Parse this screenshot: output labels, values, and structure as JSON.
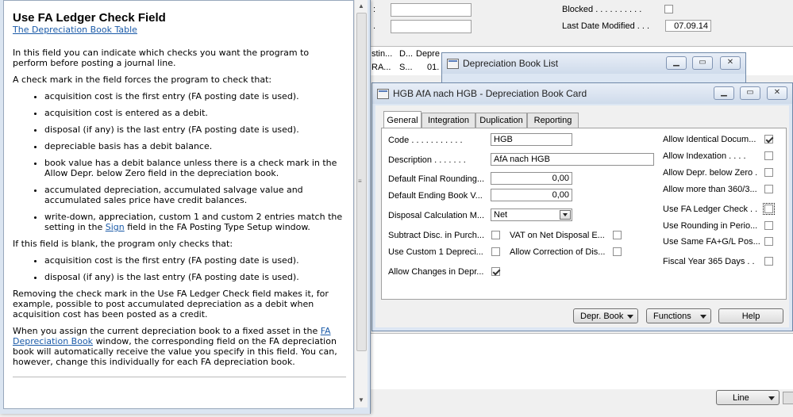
{
  "help": {
    "title": "Use FA Ledger Check Field",
    "link_top": "The Depreciation Book Table",
    "p1": "In this field you can indicate which checks you want the program to perform before posting a journal line.",
    "p2": "A check mark in the field forces the program to check that:",
    "list1": [
      "acquisition cost is the first entry (FA posting date is used).",
      "acquisition cost is entered as a debit.",
      "disposal (if any) is the last entry (FA posting date is used).",
      "depreciable basis has a debit balance.",
      "book value has a debit balance unless there is a check mark in the Allow Depr. below Zero field in the depreciation book.",
      "accumulated depreciation, accumulated salvage value and accumulated sales price have credit balances."
    ],
    "list1_last_pre": "write-down, appreciation, custom 1 and custom 2 entries match the setting in the",
    "list1_last_link": "Sign",
    "list1_last_post": "field in the FA Posting Type Setup window.",
    "p3": "If this field is blank, the program only checks that:",
    "list2": [
      "acquisition cost is the first entry (FA posting date is used).",
      "disposal (if any) is the last entry (FA posting date is used)."
    ],
    "p4": "Removing the check mark in the Use FA Ledger Check field makes it, for example, possible to post accumulated depreciation as a debit when acquisition cost has been posted as a credit.",
    "p5_pre": "When you assign the current depreciation book to a fixed asset in the",
    "p5_link": "FA Depreciation Book",
    "p5_post": "window, the corresponding field on the FA depreciation book will automatically receive the value you specify in this field. You can, however, change this individually for each FA depreciation book."
  },
  "background": {
    "blocked_label": "Blocked . . . . . . . . . .",
    "last_modified_label": "Last Date Modified . . .",
    "last_modified_value": "07.09.14",
    "col_headers": [
      "stin...",
      "D...",
      "Depre"
    ],
    "row_cells": [
      "RA...",
      "S...",
      "01."
    ],
    "line_button": "Line"
  },
  "list_window": {
    "title": "Depreciation Book List"
  },
  "card": {
    "title": "HGB AfA nach HGB - Depreciation Book Card",
    "tabs": [
      "General",
      "Integration",
      "Duplication",
      "Reporting"
    ],
    "code_label": "Code . . . . . . . . . . .",
    "code_value": "HGB",
    "description_label": "Description . . . . . . .",
    "description_value": "AfA nach HGB",
    "default_final_label": "Default Final Rounding...",
    "default_final_value": "0,00",
    "default_ending_label": "Default Ending Book V...",
    "default_ending_value": "0,00",
    "disposal_label": "Disposal Calculation M...",
    "disposal_value": "Net",
    "subtract_label": "Subtract Disc. in Purch...",
    "vat_label": "VAT on Net Disposal E...",
    "custom1_label": "Use Custom 1 Depreci...",
    "correction_label": "Allow Correction of Dis...",
    "changes_label": "Allow Changes in Depr...",
    "right_labels": [
      "Allow Identical Docum...",
      "Allow Indexation . . . .",
      "Allow Depr. below Zero .",
      "Allow more than 360/3...",
      "Use FA Ledger Check . .",
      "Use Rounding in Perio...",
      "Use Same FA+G/L Pos...",
      "Fiscal Year 365 Days . ."
    ],
    "btn_depr_book": "Depr. Book",
    "btn_functions": "Functions",
    "btn_help": "Help"
  }
}
